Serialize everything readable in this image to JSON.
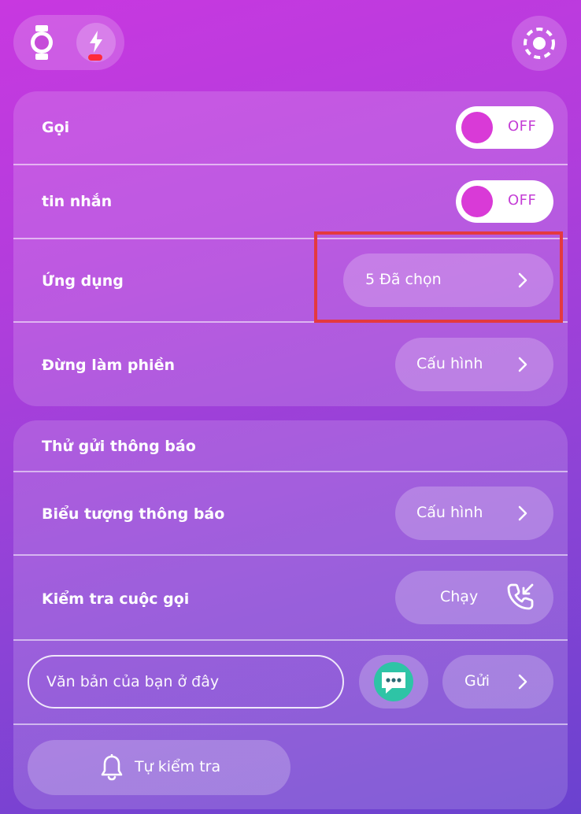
{
  "top_bar": {
    "watch_icon": "watch-icon",
    "power_icon": "lightning-bolt-icon",
    "settings_icon": "settings-dashed-circle-icon"
  },
  "colors": {
    "toggle_knob": "#d93ad7",
    "toggle_text": "#c43ed6",
    "highlight_border": "#e4393f",
    "power_dot": "#ff2a3a",
    "message_icon_bg": "#2ec4a6"
  },
  "notifications_card": {
    "calls": {
      "label": "Gọi",
      "toggle": "OFF"
    },
    "messages": {
      "label": "tin nhắn",
      "toggle": "OFF"
    },
    "apps": {
      "label": "Ứng dụng",
      "value": "5 Đã chọn"
    },
    "dnd": {
      "label": "Đừng làm phiền",
      "button": "Cấu hình"
    }
  },
  "test_card": {
    "title": "Thử gửi thông báo",
    "notif_icon": {
      "label": "Biểu tượng thông báo",
      "button": "Cấu hình"
    },
    "call_test": {
      "label": "Kiểm tra cuộc gọi",
      "button": "Chạy"
    },
    "text_input": {
      "placeholder": "Văn bản của bạn ở đây",
      "value": ""
    },
    "send_button": "Gửi",
    "self_test_button": "Tự kiểm tra"
  }
}
